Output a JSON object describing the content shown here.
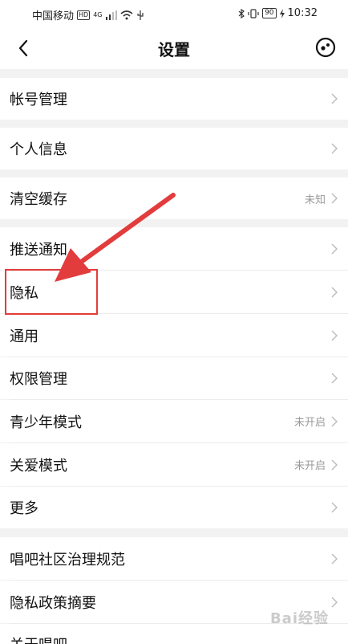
{
  "status_bar": {
    "carrier": "中国移动",
    "hd_badge": "HD",
    "net_badge": "4G",
    "battery": "90",
    "time": "10:32"
  },
  "header": {
    "title": "设置"
  },
  "settings": {
    "account": "帐号管理",
    "personal_info": "个人信息",
    "clear_cache": "清空缓存",
    "clear_cache_value": "未知",
    "push": "推送通知",
    "privacy": "隐私",
    "general": "通用",
    "permissions": "权限管理",
    "teen_mode": "青少年模式",
    "teen_mode_value": "未开启",
    "care_mode": "关爱模式",
    "care_mode_value": "未开启",
    "more": "更多",
    "community_rules": "唱吧社区治理规范",
    "privacy_summary": "隐私政策摘要",
    "about": "关于唱吧"
  },
  "watermark": "Bai经验",
  "colors": {
    "annotation": "#e23c3c",
    "background": "#f2f2f2"
  }
}
